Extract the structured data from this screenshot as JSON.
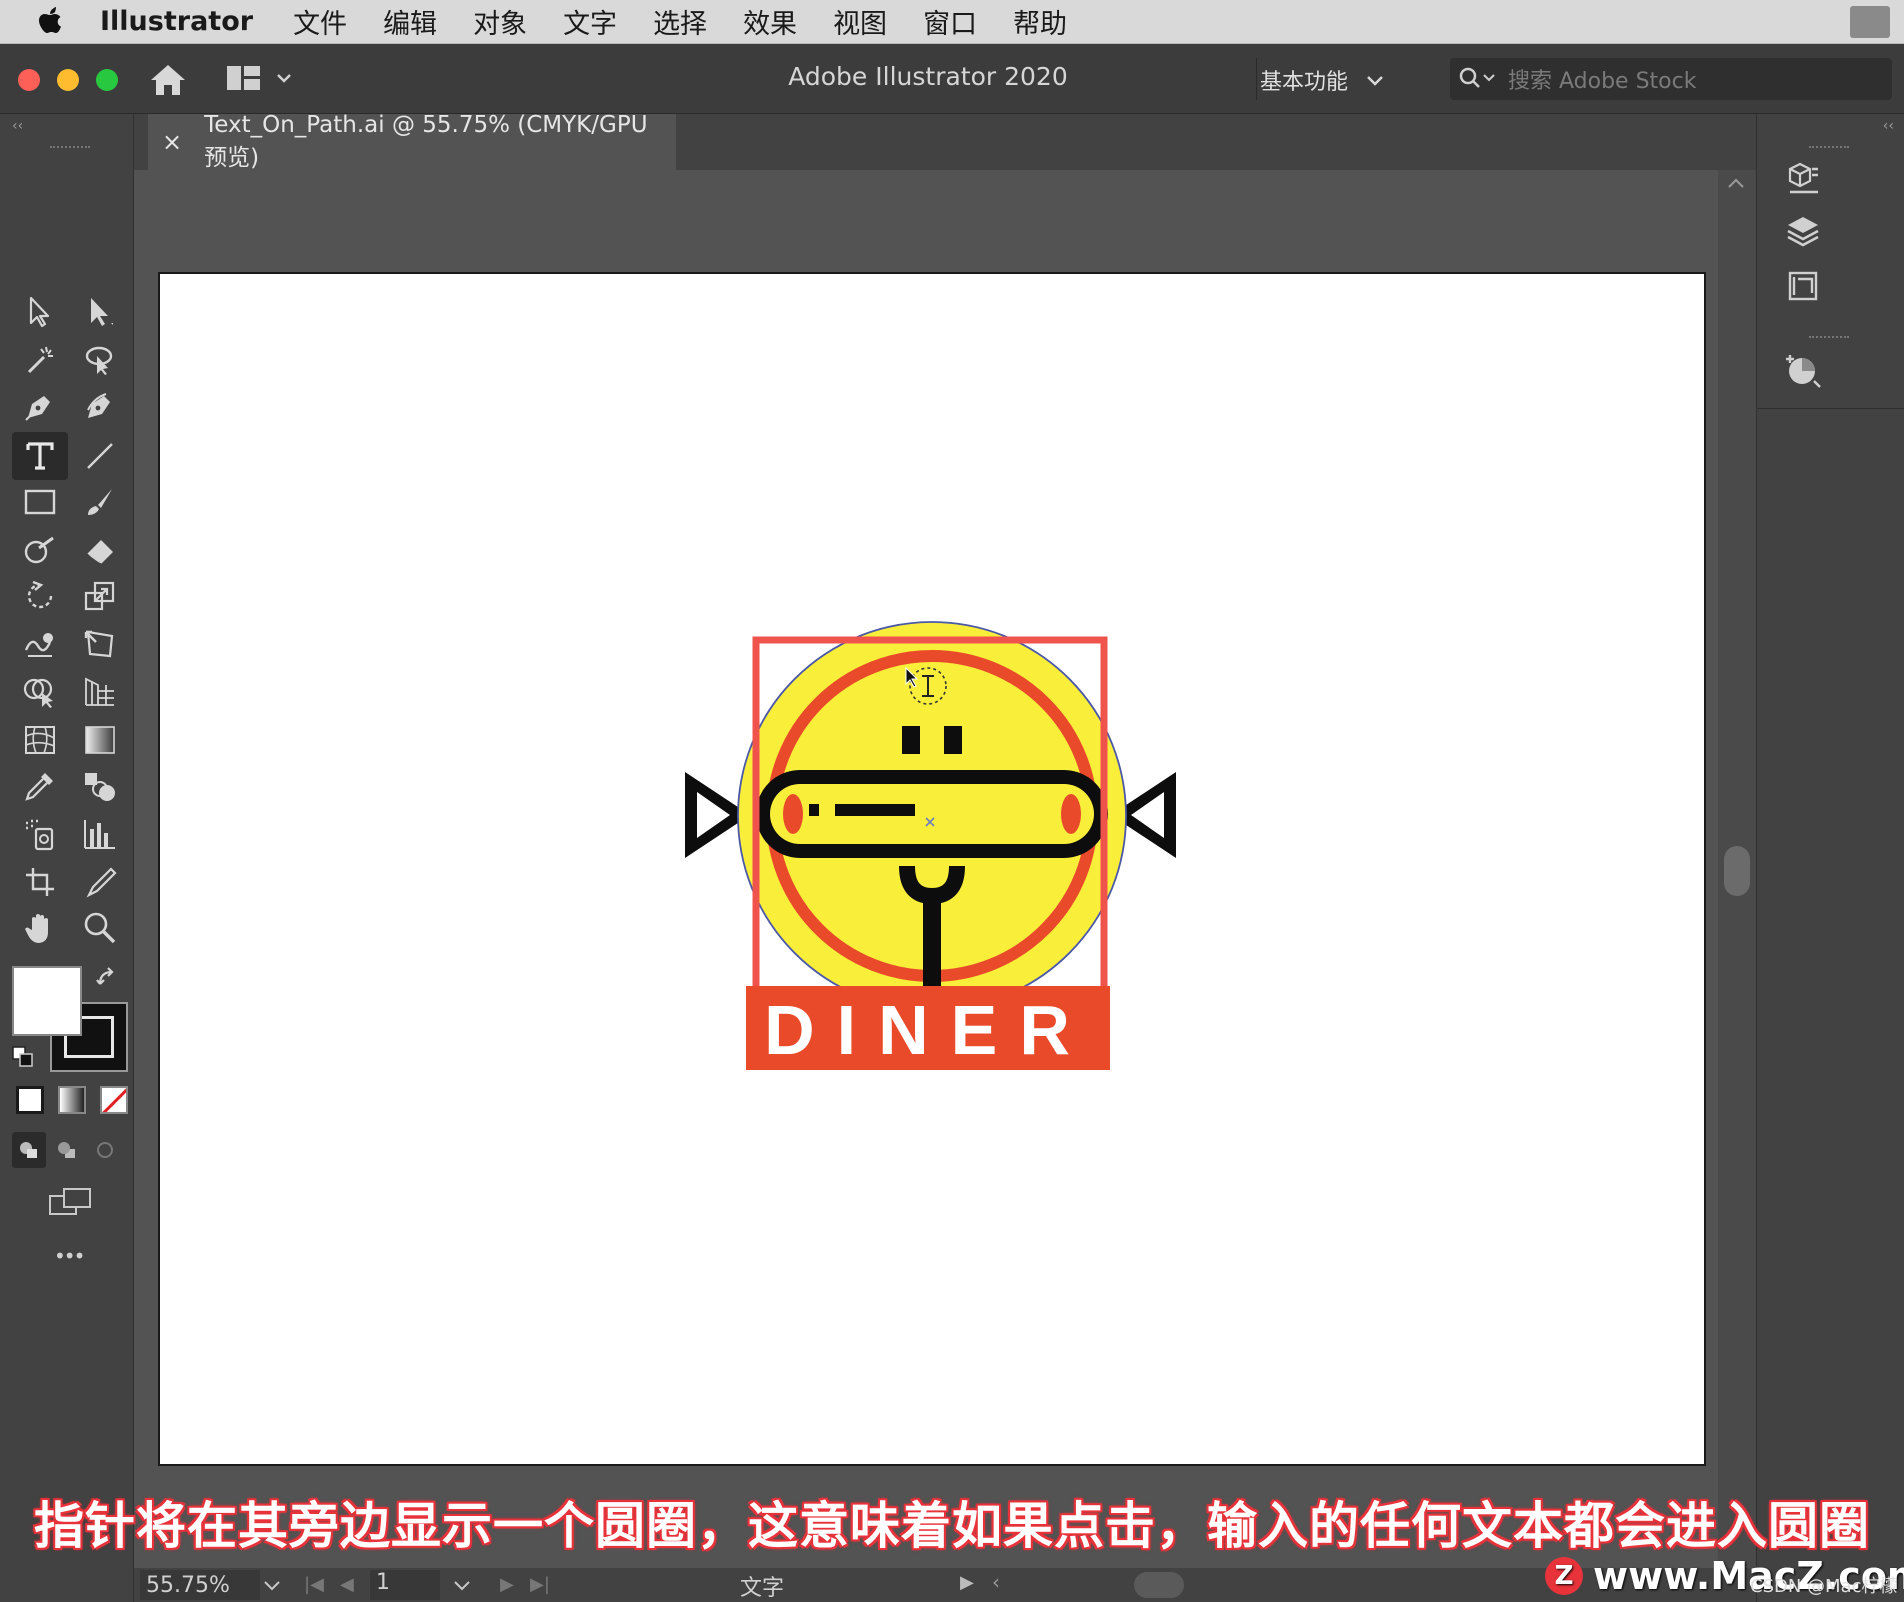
{
  "menubar": {
    "app_name": "Illustrator",
    "items": [
      "文件",
      "编辑",
      "对象",
      "文字",
      "选择",
      "效果",
      "视图",
      "窗口",
      "帮助"
    ]
  },
  "titlebar": {
    "title": "Adobe Illustrator 2020",
    "workspace": "基本功能",
    "search_placeholder": "搜索 Adobe Stock"
  },
  "document_tab": {
    "close_glyph": "×",
    "label": "Text_On_Path.ai @ 55.75% (CMYK/GPU 预览)"
  },
  "toolbar": {
    "tools": [
      [
        "selection-tool-icon",
        "direct-selection-tool-icon"
      ],
      [
        "magic-wand-tool-icon",
        "lasso-tool-icon"
      ],
      [
        "pen-tool-icon",
        "curvature-tool-icon"
      ],
      [
        "type-tool-icon",
        "line-segment-tool-icon"
      ],
      [
        "rectangle-tool-icon",
        "paintbrush-tool-icon"
      ],
      [
        "shaper-tool-icon",
        "eraser-tool-icon"
      ],
      [
        "rotate-tool-icon",
        "scale-tool-icon"
      ],
      [
        "warp-tool-icon",
        "free-transform-tool-icon"
      ],
      [
        "shape-builder-tool-icon",
        "perspective-grid-tool-icon"
      ],
      [
        "mesh-tool-icon",
        "gradient-tool-icon"
      ],
      [
        "eyedropper-tool-icon",
        "blend-tool-icon"
      ],
      [
        "symbol-sprayer-tool-icon",
        "column-graph-tool-icon"
      ],
      [
        "artboard-tool-icon",
        "slice-tool-icon"
      ],
      [
        "hand-tool-icon",
        "zoom-tool-icon"
      ]
    ],
    "active_tool": "type-tool-icon",
    "more_glyph": "•••"
  },
  "artwork": {
    "logo_text": "DINER",
    "colors": {
      "yellow": "#f9ee3a",
      "red": "#e94b2a",
      "frame": "#f0534c",
      "black": "#0d0d0d"
    }
  },
  "statusbar": {
    "zoom": "55.75%",
    "artboard_number": "1",
    "current_tool": "文字"
  },
  "subtitle": "指针将在其旁边显示一个圆圈，这意味着如果点击，输入的任何文本都会进入圆圈",
  "watermark": {
    "logo_letter": "Z",
    "text": "www.MacZ.com",
    "credit": "CSDN @Mac柠檬"
  }
}
